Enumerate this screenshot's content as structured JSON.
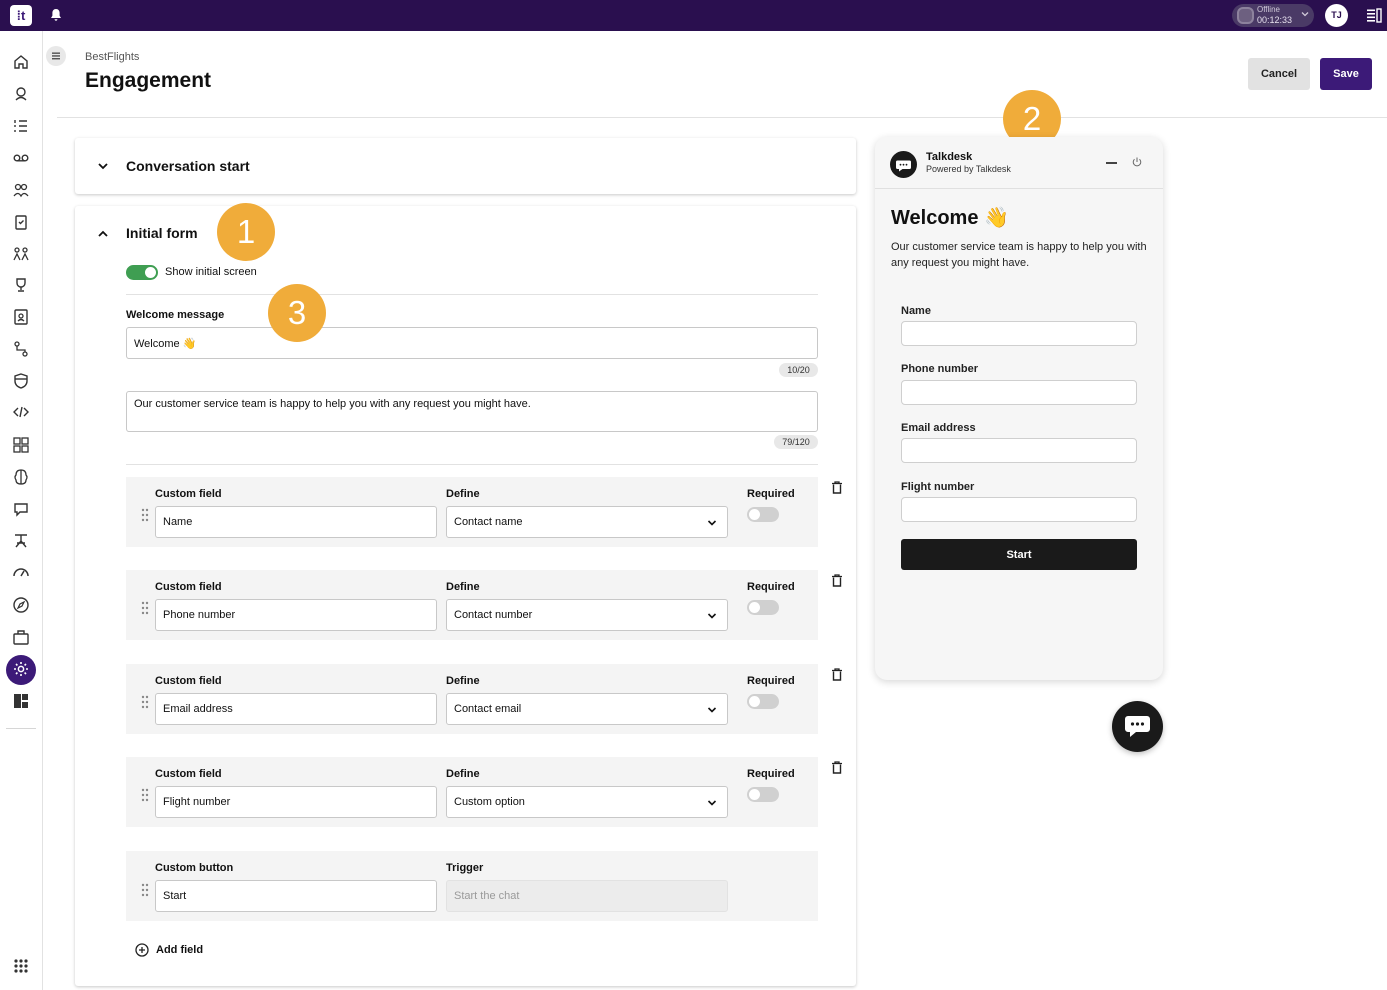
{
  "topbar": {
    "logo_text": "⁞t",
    "status_label": "Offline",
    "status_timer": "00:12:33",
    "avatar_initials": "TJ"
  },
  "header": {
    "breadcrumb": "BestFlights",
    "title": "Engagement",
    "cancel_label": "Cancel",
    "save_label": "Save"
  },
  "sections": {
    "conversation_start": "Conversation start",
    "initial_form": "Initial form"
  },
  "initial_form": {
    "toggle_label": "Show initial screen",
    "welcome_label": "Welcome message",
    "welcome_value": "Welcome 👋",
    "welcome_counter": "10/20",
    "description_value": "Our customer service team is happy to help you with any request you might have.",
    "description_counter": "79/120",
    "col_custom_field": "Custom field",
    "col_define": "Define",
    "col_required": "Required",
    "fields": [
      {
        "name": "Name",
        "define": "Contact name",
        "required": false
      },
      {
        "name": "Phone number",
        "define": "Contact number",
        "required": false
      },
      {
        "name": "Email address",
        "define": "Contact email",
        "required": false
      },
      {
        "name": "Flight number",
        "define": "Custom option",
        "required": false
      }
    ],
    "button_row": {
      "label": "Custom button",
      "trigger_label": "Trigger",
      "value": "Start",
      "trigger_value": "Start the chat"
    },
    "add_field_label": "Add field"
  },
  "callouts": [
    "1",
    "2",
    "3"
  ],
  "widget": {
    "brand": "Talkdesk",
    "powered_by": "Powered by Talkdesk",
    "welcome": "Welcome 👋",
    "subtitle": "Our customer service team is happy to help you with any request you might have.",
    "field_labels": [
      "Name",
      "Phone number",
      "Email address",
      "Flight number"
    ],
    "start_label": "Start"
  },
  "colors": {
    "brand_purple": "#3c1a78",
    "topbar": "#2a0f4f",
    "toggle_on": "#3f9e52",
    "callout": "#f0ac3a"
  },
  "icons": {
    "sidenav": [
      "home-icon",
      "conversations-icon",
      "list-icon",
      "voicemail-icon",
      "team-icon",
      "clipboard-icon",
      "people-icon",
      "trophy-icon",
      "contacts-icon",
      "flow-icon",
      "shield-icon",
      "code-icon",
      "apps-icon",
      "ai-brain-icon",
      "chat-bubble-icon",
      "agent-icon",
      "speedometer-icon",
      "compass-icon",
      "briefcase-icon",
      "settings-icon",
      "dashboard-icon",
      "app-grid-icon"
    ]
  }
}
